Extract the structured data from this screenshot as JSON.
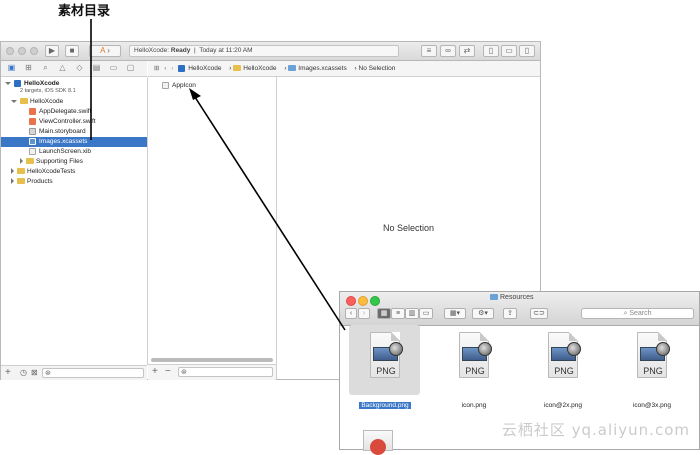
{
  "callout": {
    "label": "素材目录"
  },
  "toolbar": {
    "project_name": "HelloXcode",
    "status_state": "Ready",
    "status_time": "Today at 11:20 AM"
  },
  "jump_bar": {
    "items": [
      "HelloXcode",
      "HelloXcode",
      "Images.xcassets",
      "No Selection"
    ]
  },
  "navigator": {
    "project": {
      "name": "HelloXcode",
      "subtitle": "2 targets, iOS SDK 8.1"
    },
    "items": [
      {
        "label": "HelloXcode"
      },
      {
        "label": "AppDelegate.swift"
      },
      {
        "label": "ViewController.swift"
      },
      {
        "label": "Main.storyboard"
      },
      {
        "label": "Images.xcassets"
      },
      {
        "label": "LaunchScreen.xib"
      },
      {
        "label": "Supporting Files"
      },
      {
        "label": "HelloXcodeTests"
      },
      {
        "label": "Products"
      }
    ],
    "bottom_buttons": [
      "+"
    ]
  },
  "asset_catalog": {
    "items": [
      {
        "label": "AppIcon"
      }
    ],
    "bottom_buttons": [
      "+",
      "−"
    ]
  },
  "editor": {
    "empty_text": "No Selection"
  },
  "finder": {
    "title": "Resources",
    "search_placeholder": "Search",
    "files": [
      {
        "icon_text": "PNG",
        "name": "Background.png"
      },
      {
        "icon_text": "PNG",
        "name": "icon.png"
      },
      {
        "icon_text": "PNG",
        "name": "icon@2x.png"
      },
      {
        "icon_text": "PNG",
        "name": "icon@3x.png"
      }
    ]
  },
  "watermark": {
    "text": "云栖社区 yq.aliyun.com"
  },
  "colors": {
    "selection": "#3b77c7",
    "folder": "#e6bf4c",
    "arrow": "#000000"
  }
}
